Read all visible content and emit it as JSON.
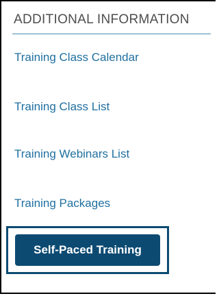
{
  "section": {
    "title": "ADDITIONAL INFORMATION"
  },
  "links": [
    {
      "label": "Training Class Calendar"
    },
    {
      "label": "Training Class List"
    },
    {
      "label": "Training Webinars List"
    },
    {
      "label": "Training Packages"
    }
  ],
  "cta": {
    "label": "Self-Paced Training"
  },
  "colors": {
    "header_text": "#4d4d4d",
    "link": "#1f6f9f",
    "divider": "#4a8bb5",
    "button_bg": "#0c4a72",
    "button_text": "#ffffff"
  }
}
